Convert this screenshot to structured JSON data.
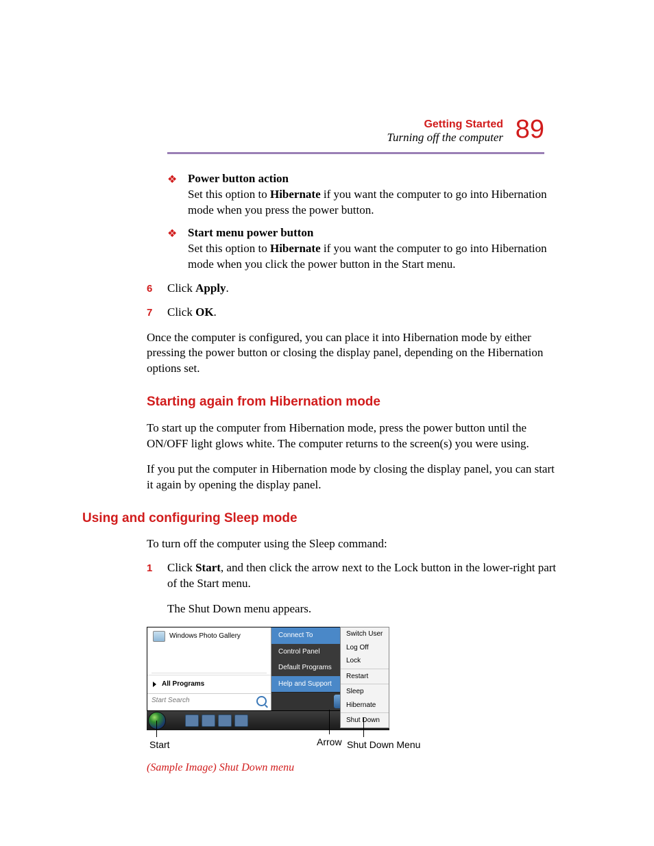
{
  "header": {
    "chapter": "Getting Started",
    "section": "Turning off the computer",
    "page_number": "89"
  },
  "bullet1": {
    "title": "Power button action",
    "text_a": "Set this option to ",
    "text_b": "Hibernate",
    "text_c": " if you want the computer to go into Hibernation mode when you press the power button."
  },
  "bullet2": {
    "title": "Start menu power button",
    "text_a": "Set this option to ",
    "text_b": "Hibernate",
    "text_c": " if you want the computer to go into Hibernation mode when you click the power button in the Start menu."
  },
  "step6": {
    "num": "6",
    "a": "Click ",
    "b": "Apply",
    "c": "."
  },
  "step7": {
    "num": "7",
    "a": "Click ",
    "b": "OK",
    "c": "."
  },
  "para1": "Once the computer is configured, you can place it into Hibernation mode by either pressing the power button or closing the display panel, depending on the Hibernation options set.",
  "h2a": "Starting again from Hibernation mode",
  "para2": "To start up the computer from Hibernation mode, press the power button until the ON/OFF light glows white. The computer returns to the screen(s) you were using.",
  "para3": "If you put the computer in Hibernation mode by closing the display panel, you can start it again by opening the display panel.",
  "h2b": "Using and configuring Sleep mode",
  "para4": "To turn off the computer using the Sleep command:",
  "step1": {
    "num": "1",
    "a": "Click ",
    "b": "Start",
    "c": ", and then click the arrow next to the Lock button in the lower-right part of the Start menu."
  },
  "para5": "The Shut Down menu appears.",
  "startmenu": {
    "left_top_item": "Windows Photo Gallery",
    "all_programs": "All Programs",
    "search_placeholder": "Start Search",
    "right_items": [
      "Connect To",
      "Control Panel",
      "Default Programs",
      "Help and Support"
    ]
  },
  "shutdown_menu": {
    "items": [
      "Switch User",
      "Log Off",
      "Lock",
      "Restart",
      "Sleep",
      "Hibernate",
      "Shut Down"
    ]
  },
  "callouts": {
    "start": "Start",
    "arrow": "Arrow",
    "sd_menu": "Shut Down Menu"
  },
  "caption": "(Sample Image) Shut Down menu"
}
